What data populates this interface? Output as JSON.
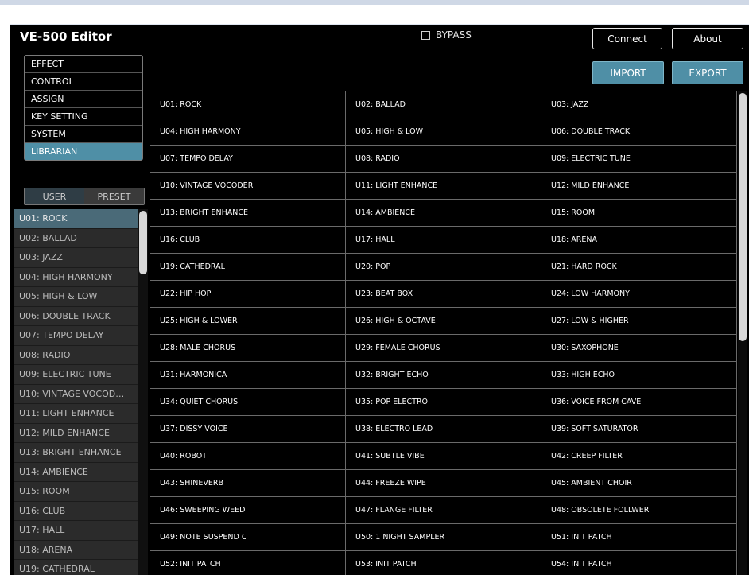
{
  "app": {
    "title": "VE-500 Editor",
    "bypass_label": "BYPASS"
  },
  "buttons": {
    "connect": "Connect",
    "about": "About",
    "import": "IMPORT",
    "export": "EXPORT"
  },
  "menu": [
    {
      "label": "EFFECT"
    },
    {
      "label": "CONTROL"
    },
    {
      "label": "ASSIGN"
    },
    {
      "label": "KEY SETTING"
    },
    {
      "label": "SYSTEM"
    },
    {
      "label": "LIBRARIAN",
      "active": true
    }
  ],
  "toggle": {
    "user": "USER",
    "preset": "PRESET"
  },
  "patch_list": [
    "U01: ROCK",
    "U02: BALLAD",
    "U03: JAZZ",
    "U04: HIGH HARMONY",
    "U05: HIGH & LOW",
    "U06: DOUBLE TRACK",
    "U07: TEMPO DELAY",
    "U08: RADIO",
    "U09: ELECTRIC TUNE",
    "U10: VINTAGE VOCOD…",
    "U11: LIGHT ENHANCE",
    "U12: MILD ENHANCE",
    "U13: BRIGHT ENHANCE",
    "U14: AMBIENCE",
    "U15: ROOM",
    "U16: CLUB",
    "U17: HALL",
    "U18: ARENA",
    "U19: CATHEDRAL"
  ],
  "patch_grid": [
    [
      "U01: ROCK",
      "U02: BALLAD",
      "U03: JAZZ"
    ],
    [
      "U04: HIGH HARMONY",
      "U05: HIGH & LOW",
      "U06: DOUBLE TRACK"
    ],
    [
      "U07: TEMPO DELAY",
      "U08: RADIO",
      "U09: ELECTRIC TUNE"
    ],
    [
      "U10: VINTAGE VOCODER",
      "U11: LIGHT ENHANCE",
      "U12: MILD ENHANCE"
    ],
    [
      "U13: BRIGHT ENHANCE",
      "U14: AMBIENCE",
      "U15: ROOM"
    ],
    [
      "U16: CLUB",
      "U17: HALL",
      "U18: ARENA"
    ],
    [
      "U19: CATHEDRAL",
      "U20: POP",
      "U21: HARD ROCK"
    ],
    [
      "U22: HIP HOP",
      "U23: BEAT BOX",
      "U24: LOW HARMONY"
    ],
    [
      "U25: HIGH & LOWER",
      "U26: HIGH & OCTAVE",
      "U27: LOW & HIGHER"
    ],
    [
      "U28: MALE CHORUS",
      "U29: FEMALE CHORUS",
      "U30: SAXOPHONE"
    ],
    [
      "U31: HARMONICA",
      "U32: BRIGHT ECHO",
      "U33: HIGH ECHO"
    ],
    [
      "U34: QUIET CHORUS",
      "U35: POP ELECTRO",
      "U36: VOICE FROM CAVE"
    ],
    [
      "U37: DISSY VOICE",
      "U38: ELECTRO LEAD",
      "U39: SOFT SATURATOR"
    ],
    [
      "U40: ROBOT",
      "U41: SUBTLE VIBE",
      "U42: CREEP FILTER"
    ],
    [
      "U43: SHINEVERB",
      "U44: FREEZE WIPE",
      "U45: AMBIENT CHOIR"
    ],
    [
      "U46: SWEEPING WEED",
      "U47: FLANGE FILTER",
      "U48: OBSOLETE FOLLWER"
    ],
    [
      "U49: NOTE SUSPEND C",
      "U50: 1 NIGHT SAMPLER",
      "U51: INIT PATCH"
    ],
    [
      "U52: INIT PATCH",
      "U53: INIT PATCH",
      "U54: INIT PATCH"
    ]
  ],
  "colors": {
    "accent": "#4f8fa6",
    "background": "#000000",
    "list_bg": "#2b2b2b"
  }
}
